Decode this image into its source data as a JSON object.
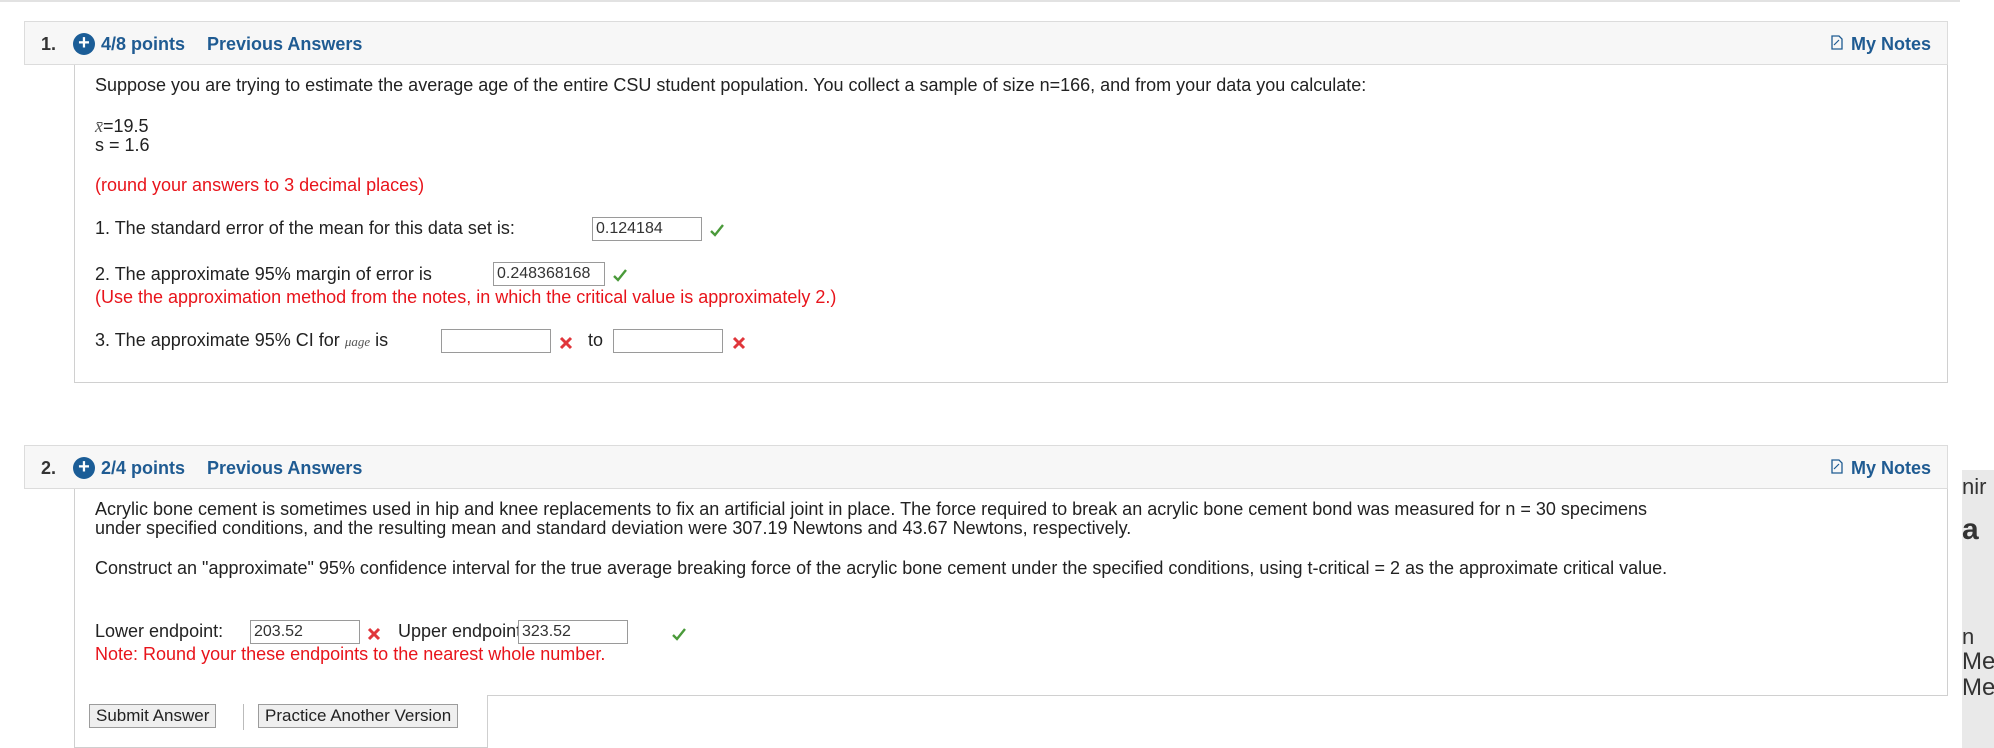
{
  "q1": {
    "number": "1.",
    "points": "4/8 points",
    "previous_answers": "Previous Answers",
    "my_notes": "My Notes",
    "intro": "Suppose you are trying to estimate the average age of the entire CSU student population. You collect a sample of size n=166, and from your data you calculate:",
    "xbar_symbol": "x̄",
    "xbar_value": "=19.5",
    "s_line": "s = 1.6",
    "round_note": "(round your answers to 3 decimal places)",
    "item1_label": "1. The standard error of the mean for this data set is:",
    "item1_value": "0.124184",
    "item2_label": "2. The approximate 95% margin of error is",
    "item2_value": "0.248368168",
    "item2_hint": "(Use the approximation method from the notes, in which the critical value is approximately 2.)",
    "item3_label": "3. The approximate 95% CI for",
    "item3_mu": "μage",
    "item3_is": "is",
    "item3_to": "to",
    "item3_low": "",
    "item3_high": ""
  },
  "q2": {
    "number": "2.",
    "points": "2/4 points",
    "previous_answers": "Previous Answers",
    "my_notes": "My Notes",
    "para1_line1": "Acrylic bone cement is sometimes used in hip and knee replacements to fix an artificial joint in place. The force required to break an acrylic bone cement bond was measured for n = 30 specimens",
    "para1_line2": "under specified conditions, and the resulting mean and standard deviation were 307.19 Newtons and 43.67 Newtons, respectively.",
    "para2": "Construct an \"approximate\" 95% confidence interval for the true average breaking force of the acrylic bone cement under the specified conditions, using t-critical = 2 as the approximate critical value.",
    "lower_label": "Lower endpoint:",
    "lower_value": "203.52",
    "upper_label": "Upper endpoint:",
    "upper_value": "323.52",
    "note": "Note: Round your these endpoints to the nearest whole number."
  },
  "buttons": {
    "submit": "Submit Answer",
    "practice": "Practice Another Version"
  },
  "right_panel_fragments": [
    "nir",
    "a",
    "n",
    "Me",
    "Me"
  ],
  "colors": {
    "link_blue": "#1f5b92",
    "error_red": "#e8141b",
    "check_green": "#4a9a3a"
  }
}
